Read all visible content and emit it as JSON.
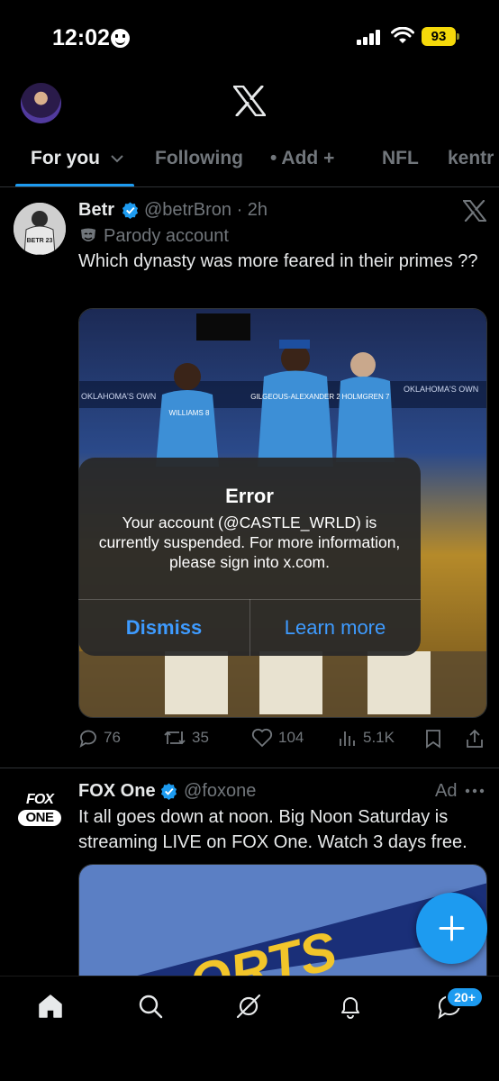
{
  "status_bar": {
    "time": "12:02",
    "battery": "93"
  },
  "tabs": [
    {
      "label": "For you",
      "active": true
    },
    {
      "label": "Following"
    },
    {
      "label": "• Add +"
    },
    {
      "label": "NFL"
    },
    {
      "label": "kentr"
    }
  ],
  "tweets": [
    {
      "name": "Betr",
      "handle": "@betrBron · 2h",
      "label": "Parody account",
      "text": "Which dynasty was more feared in their primes ??",
      "avatar_text": "BETR 23",
      "media_jerseys": [
        "WILLIAMS 8",
        "GILGEOUS-ALEXANDER 2",
        "HOLMGREN 7"
      ],
      "media_scoreboard": "OKLAHOMA'S OWN",
      "actions": {
        "replies": "76",
        "reposts": "35",
        "likes": "104",
        "views": "5.1K"
      }
    },
    {
      "name": "FOX One",
      "handle": "@foxone",
      "ad_label": "Ad",
      "logo_lines": [
        "FOX",
        "ONE"
      ],
      "text": "It all goes down at noon. Big Noon Saturday is streaming LIVE on FOX One. Watch 3 days free.",
      "media_text": "ORTS"
    }
  ],
  "dialog": {
    "title": "Error",
    "message": "Your account (@CASTLE_WRLD) is currently suspended. For more information, please sign into x.com.",
    "dismiss": "Dismiss",
    "learn_more": "Learn more"
  },
  "bottom_nav": {
    "badge": "20+"
  },
  "colors": {
    "accent": "#1d9bf0",
    "dialog_button": "#3e9bff",
    "muted": "#71767b"
  }
}
